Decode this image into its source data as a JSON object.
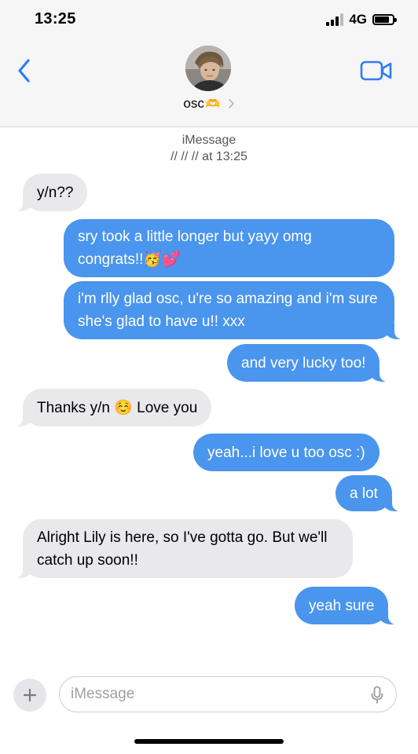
{
  "status_bar": {
    "time": "13:25",
    "network": "4G",
    "battery_level": 0.8
  },
  "header": {
    "contact_name": "osc",
    "contact_emoji": "🫶",
    "back_icon": "chevron-left-icon",
    "video_icon": "video-camera-icon"
  },
  "thread": {
    "service": "iMessage",
    "timestamp": "// // // at 13:25"
  },
  "messages": [
    {
      "direction": "incoming",
      "text": "y/n??"
    },
    {
      "direction": "outgoing",
      "text": "sry took a little longer but yayy omg congrats!!🥳💕"
    },
    {
      "direction": "outgoing",
      "text": "i'm rlly glad osc, u're so amazing and i'm sure she's glad to have u!! xxx"
    },
    {
      "direction": "outgoing",
      "text": "and very lucky too!"
    },
    {
      "direction": "incoming",
      "text": "Thanks y/n ☺️ Love you"
    },
    {
      "direction": "outgoing",
      "text": "yeah...i love u too osc :)"
    },
    {
      "direction": "outgoing",
      "text": "a lot"
    },
    {
      "direction": "incoming",
      "text": "Alright Lily is here, so I've gotta go. But we'll catch up soon!!"
    },
    {
      "direction": "outgoing",
      "text": "yeah sure"
    }
  ],
  "composer": {
    "placeholder": "iMessage",
    "value": ""
  },
  "colors": {
    "outgoing_bubble": "#4a95ed",
    "incoming_bubble": "#e9e9eb",
    "accent": "#2f7cf6"
  }
}
